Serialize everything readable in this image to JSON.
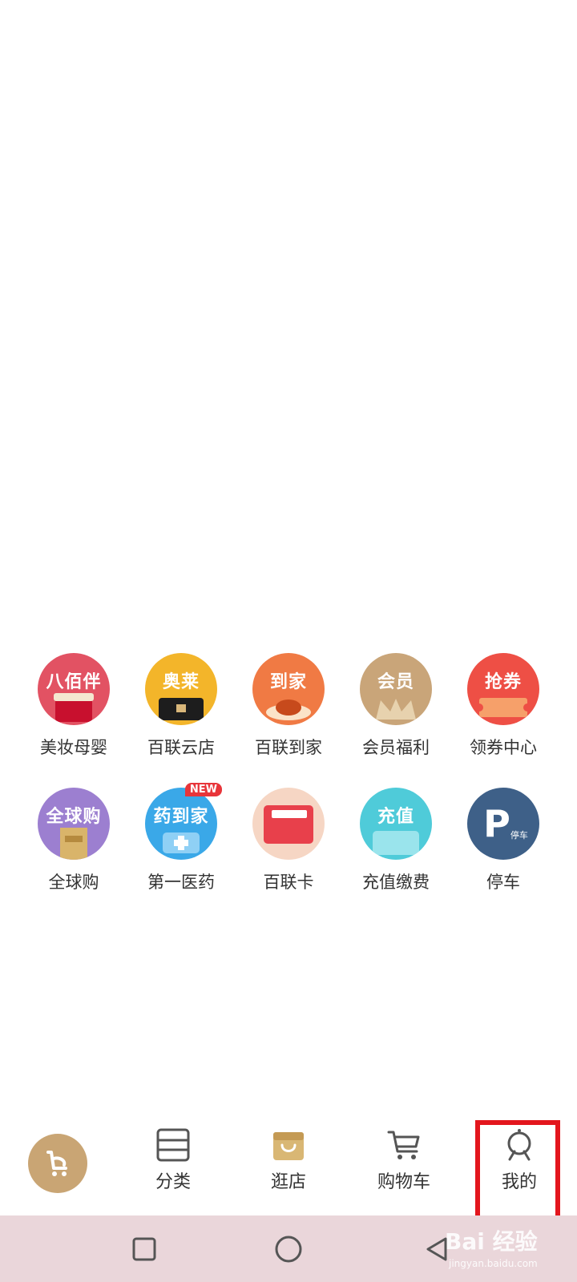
{
  "grid": {
    "row1": [
      {
        "title": "八佰伴",
        "label": "美妆母婴",
        "color": "#e25263"
      },
      {
        "title": "奥莱",
        "label": "百联云店",
        "color": "#f3b52a"
      },
      {
        "title": "到家",
        "label": "百联到家",
        "color": "#f07a44"
      },
      {
        "title": "会员",
        "label": "会员福利",
        "color": "#c9a579"
      },
      {
        "title": "抢券",
        "label": "领券中心",
        "color": "#ee4f45"
      }
    ],
    "row2": [
      {
        "title": "全球购",
        "label": "全球购",
        "color": "#9c7fd0"
      },
      {
        "title": "药到家",
        "label": "第一医药",
        "color": "#3aa8e8",
        "badge": "NEW"
      },
      {
        "title": "",
        "label": "百联卡",
        "color": "#f6d6c4"
      },
      {
        "title": "充值",
        "label": "充值缴费",
        "color": "#4fcbd9"
      },
      {
        "title": "P",
        "sub": "停车",
        "label": "停车",
        "color": "#3e6088"
      }
    ]
  },
  "tabbar": {
    "home_icon": "shopping-cart-logo-icon",
    "tabs": [
      {
        "label": "分类",
        "icon": "category-list-icon"
      },
      {
        "label": "逛店",
        "icon": "shopping-bag-icon"
      },
      {
        "label": "购物车",
        "icon": "cart-icon"
      },
      {
        "label": "我的",
        "icon": "profile-icon"
      }
    ]
  },
  "navbar": {
    "buttons": [
      "recent-apps-icon",
      "home-circle-icon",
      "back-triangle-icon"
    ]
  },
  "watermark": {
    "text": "Bai 经验",
    "sub": "jingyan.baidu.com"
  },
  "colors": {
    "accent": "#c9a574",
    "highlight": "#e3161d",
    "navbar": "#ead6da"
  }
}
